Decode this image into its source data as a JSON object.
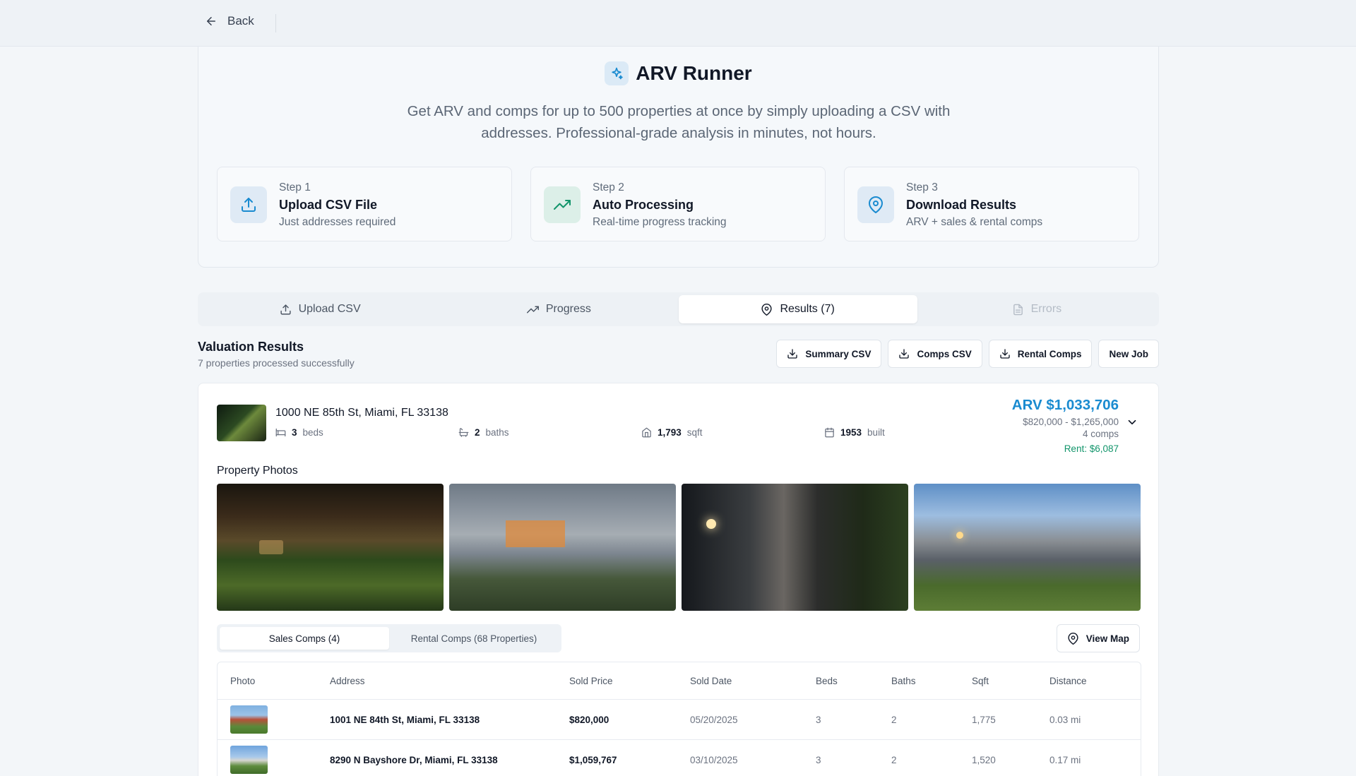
{
  "nav": {
    "back_label": "Back"
  },
  "hero": {
    "title": "ARV Runner",
    "description": "Get ARV and comps for up to 500 properties at once by simply uploading a CSV with addresses. Professional-grade analysis in minutes, not hours.",
    "steps": [
      {
        "label": "Step 1",
        "title": "Upload CSV File",
        "subtitle": "Just addresses required",
        "icon": "upload-icon"
      },
      {
        "label": "Step 2",
        "title": "Auto Processing",
        "subtitle": "Real-time progress tracking",
        "icon": "trending-up-icon"
      },
      {
        "label": "Step 3",
        "title": "Download Results",
        "subtitle": "ARV + sales & rental comps",
        "icon": "map-pin-icon"
      }
    ]
  },
  "tabs": [
    {
      "label": "Upload CSV",
      "icon": "upload-icon"
    },
    {
      "label": "Progress",
      "icon": "trending-up-icon"
    },
    {
      "label": "Results (7)",
      "icon": "map-pin-icon",
      "active": true
    },
    {
      "label": "Errors",
      "icon": "file-icon",
      "disabled": true
    }
  ],
  "results": {
    "title": "Valuation Results",
    "subtitle": "7 properties processed successfully",
    "actions": {
      "summary_csv": "Summary CSV",
      "comps_csv": "Comps CSV",
      "rental_comps": "Rental Comps",
      "new_job": "New Job"
    }
  },
  "property": {
    "address": "1000 NE 85th St, Miami, FL 33138",
    "beds_value": "3",
    "beds_label": "beds",
    "baths_value": "2",
    "baths_label": "baths",
    "sqft_value": "1,793",
    "sqft_label": "sqft",
    "built_value": "1953",
    "built_label": "built",
    "arv": "ARV $1,033,706",
    "range": "$820,000 - $1,265,000",
    "comps_count": "4 comps",
    "rent": "Rent: $6,087",
    "photos_title": "Property Photos",
    "subtabs": {
      "sales": "Sales Comps (4)",
      "rental": "Rental Comps (68 Properties)"
    },
    "view_map": "View Map"
  },
  "comps_table": {
    "headers": [
      "Photo",
      "Address",
      "Sold Price",
      "Sold Date",
      "Beds",
      "Baths",
      "Sqft",
      "Distance"
    ],
    "rows": [
      {
        "address": "1001 NE 84th St, Miami, FL 33138",
        "price": "$820,000",
        "date": "05/20/2025",
        "beds": "3",
        "baths": "2",
        "sqft": "1,775",
        "distance": "0.03 mi"
      },
      {
        "address": "8290 N Bayshore Dr, Miami, FL 33138",
        "price": "$1,059,767",
        "date": "03/10/2025",
        "beds": "3",
        "baths": "2",
        "sqft": "1,520",
        "distance": "0.17 mi"
      }
    ]
  },
  "colors": {
    "accent": "#1a8bd0",
    "rent": "#12956b",
    "background": "#f3f6f9"
  }
}
